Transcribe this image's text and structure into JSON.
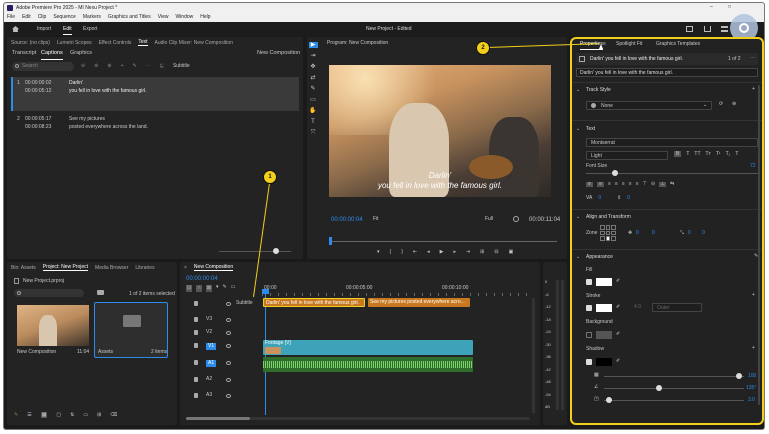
{
  "title_bar": {
    "title": "Adobe Premiere Pro 2025 - MI Nexu Project *",
    "controls": [
      "–",
      "□",
      "×"
    ]
  },
  "menu": [
    "File",
    "Edit",
    "Clip",
    "Sequence",
    "Markers",
    "Graphics and Titles",
    "View",
    "Window",
    "Help"
  ],
  "workspace": {
    "tabs": [
      "Import",
      "Edit",
      "Export"
    ],
    "project_title": "New Project - Edited"
  },
  "captions_panel": {
    "header_tabs": [
      "Source: (no clips)",
      "Lumetri Scopes",
      "Effect Controls",
      "Text",
      "Audio Clip Mixer: New Composition"
    ],
    "sub_tabs": [
      "Transcript",
      "Captions",
      "Graphics"
    ],
    "sequence": "New Composition",
    "search_placeholder": "Search",
    "subtitle_label": "Subtitle",
    "items": [
      {
        "num": "1",
        "in": "00:00:00:02",
        "out": "00:00:05:12",
        "lines": [
          "Darlin'",
          "you fell in love with the famous girl."
        ]
      },
      {
        "num": "2",
        "in": "00:00:05:17",
        "out": "00:00:08:23",
        "lines": [
          "See my pictures",
          "posted everywhere across the land."
        ]
      }
    ]
  },
  "program": {
    "tab": "Program: New Composition",
    "caption_lines": [
      "Darlin'",
      "you fell in love with the famous girl."
    ],
    "timecode": "00:00:00:04",
    "fit": "Fit",
    "quality": "Full",
    "duration": "00:00:11:04"
  },
  "tools": [
    "▶",
    "⇥",
    "✥",
    "⇄",
    "✎",
    "▭",
    "✋",
    "T",
    "⤧"
  ],
  "project_panel": {
    "tabs": [
      "Bin: Assets",
      "Project: New Project",
      "Media Browser",
      "Libraries"
    ],
    "file": "New Project.prproj",
    "selected": "1 of 2 items selected",
    "items": [
      {
        "name": "New Composition",
        "meta": "11:04"
      },
      {
        "name": "Assets",
        "meta": "2 items"
      }
    ]
  },
  "timeline": {
    "tab": "New Composition",
    "timecode": "00:00:00:04",
    "ruler": [
      "00:00",
      "00:00:05:00",
      "00:00:10:00"
    ],
    "tracks": [
      {
        "id": "",
        "label": "Subtitle"
      },
      {
        "id": "V3",
        "label": ""
      },
      {
        "id": "V2",
        "label": ""
      },
      {
        "id": "V1",
        "label": ""
      },
      {
        "id": "A1",
        "label": ""
      },
      {
        "id": "A2",
        "label": ""
      },
      {
        "id": "A3",
        "label": ""
      }
    ],
    "caption_clips": [
      "Darlin' you fell in love with the famous girl.",
      "See my pictures posted everywhere acro..."
    ],
    "video_clip": "Footage [V]"
  },
  "meter": {
    "scale": [
      "0",
      "-6",
      "-12",
      "-18",
      "-24",
      "-30",
      "-36",
      "-42",
      "-48",
      "-54",
      "dB"
    ]
  },
  "properties": {
    "tabs": [
      "Properties",
      "Spotlight Fit",
      "Graphics Templates"
    ],
    "caption_title": "Darlin' you fell in love with the famous girl.",
    "count": "1 of 2",
    "caption_text": "Darlin' you fell in love with the famous girl.",
    "track_style": {
      "title": "Track Style",
      "value": "None"
    },
    "text": {
      "title": "Text",
      "font": "Montserrat",
      "weight": "Light",
      "font_size_label": "Font Size",
      "font_size": "72"
    },
    "align": {
      "title": "Align and Transform",
      "zone": "Zone",
      "v1": "0",
      "v2": "0",
      "v3": "0",
      "v4": "0"
    },
    "appearance": {
      "title": "Appearance",
      "fill": "Fill",
      "stroke": "Stroke",
      "stroke_val": "4.0",
      "stroke_pos": "Outer",
      "background": "Background",
      "shadow": "Shadow",
      "s1": "100",
      "s2": "135°",
      "s3": "3.0"
    }
  },
  "annotations": [
    {
      "n": "1"
    },
    {
      "n": "2"
    }
  ],
  "colors": {
    "accent": "#2d8ceb",
    "highlight": "#f2cf1b",
    "caption_clip": "#c8791f",
    "video_clip": "#3da3b8",
    "audio_clip": "#5aa242"
  }
}
